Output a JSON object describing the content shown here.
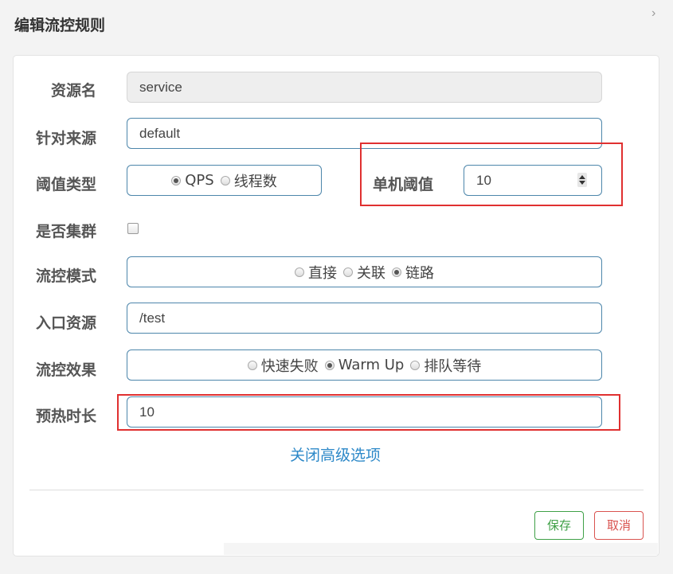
{
  "dialog": {
    "title": "编辑流控规则",
    "close_icon": "chevron-right-icon"
  },
  "form": {
    "resource_name": {
      "label": "资源名",
      "value": "service"
    },
    "limit_app": {
      "label": "针对来源",
      "value": "default"
    },
    "grade": {
      "label": "阈值类型",
      "options": [
        "QPS",
        "线程数"
      ],
      "selected": "QPS"
    },
    "threshold": {
      "label": "单机阈值",
      "value": "10"
    },
    "cluster": {
      "label": "是否集群",
      "checked": false
    },
    "strategy": {
      "label": "流控模式",
      "options": [
        "直接",
        "关联",
        "链路"
      ],
      "selected": "链路"
    },
    "ref_resource": {
      "label": "入口资源",
      "value": "/test"
    },
    "control_behavior": {
      "label": "流控效果",
      "options": [
        "快速失败",
        "Warm Up",
        "排队等待"
      ],
      "selected": "Warm Up"
    },
    "warmup_period": {
      "label": "预热时长",
      "value": "10"
    },
    "advanced_toggle": "关闭高级选项"
  },
  "footer": {
    "save_label": "保存",
    "cancel_label": "取消"
  },
  "colors": {
    "accent": "#4d86ab",
    "link": "#2c88c8",
    "save": "#3fa047",
    "cancel": "#d9534f",
    "highlight": "#e03030"
  }
}
